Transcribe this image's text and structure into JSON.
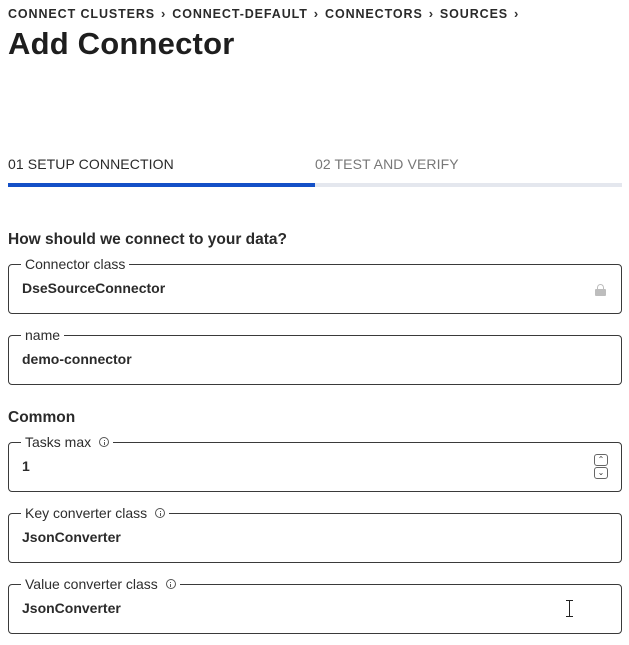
{
  "breadcrumb": [
    {
      "label": "CONNECT CLUSTERS"
    },
    {
      "label": "CONNECT-DEFAULT"
    },
    {
      "label": "CONNECTORS"
    },
    {
      "label": "SOURCES"
    }
  ],
  "page_title": "Add Connector",
  "stepper": {
    "steps": [
      {
        "label": "01 SETUP CONNECTION",
        "active": true
      },
      {
        "label": "02 TEST AND VERIFY",
        "active": false
      }
    ],
    "progress_fraction": 0.5
  },
  "sections": {
    "connect_heading": "How should we connect to your data?",
    "common_heading": "Common"
  },
  "fields": {
    "connector_class": {
      "label": "Connector class",
      "value": "DseSourceConnector",
      "locked": true
    },
    "name": {
      "label": "name",
      "value": "demo-connector"
    },
    "tasks_max": {
      "label": "Tasks max",
      "value": "1",
      "up_glyph": "⌃",
      "down_glyph": "⌄"
    },
    "key_converter_class": {
      "label": "Key converter class",
      "value": "JsonConverter"
    },
    "value_converter_class": {
      "label": "Value converter class",
      "value": "JsonConverter"
    }
  },
  "colors": {
    "accent": "#1450c7",
    "progress_track": "#e4e7ee",
    "border": "#3a3a3a",
    "lock": "#bdbdbd"
  },
  "icons": {
    "breadcrumb_separator": "chevron-right-icon",
    "info": "info-icon",
    "lock": "lock-icon",
    "cursor": "text-cursor-icon"
  }
}
